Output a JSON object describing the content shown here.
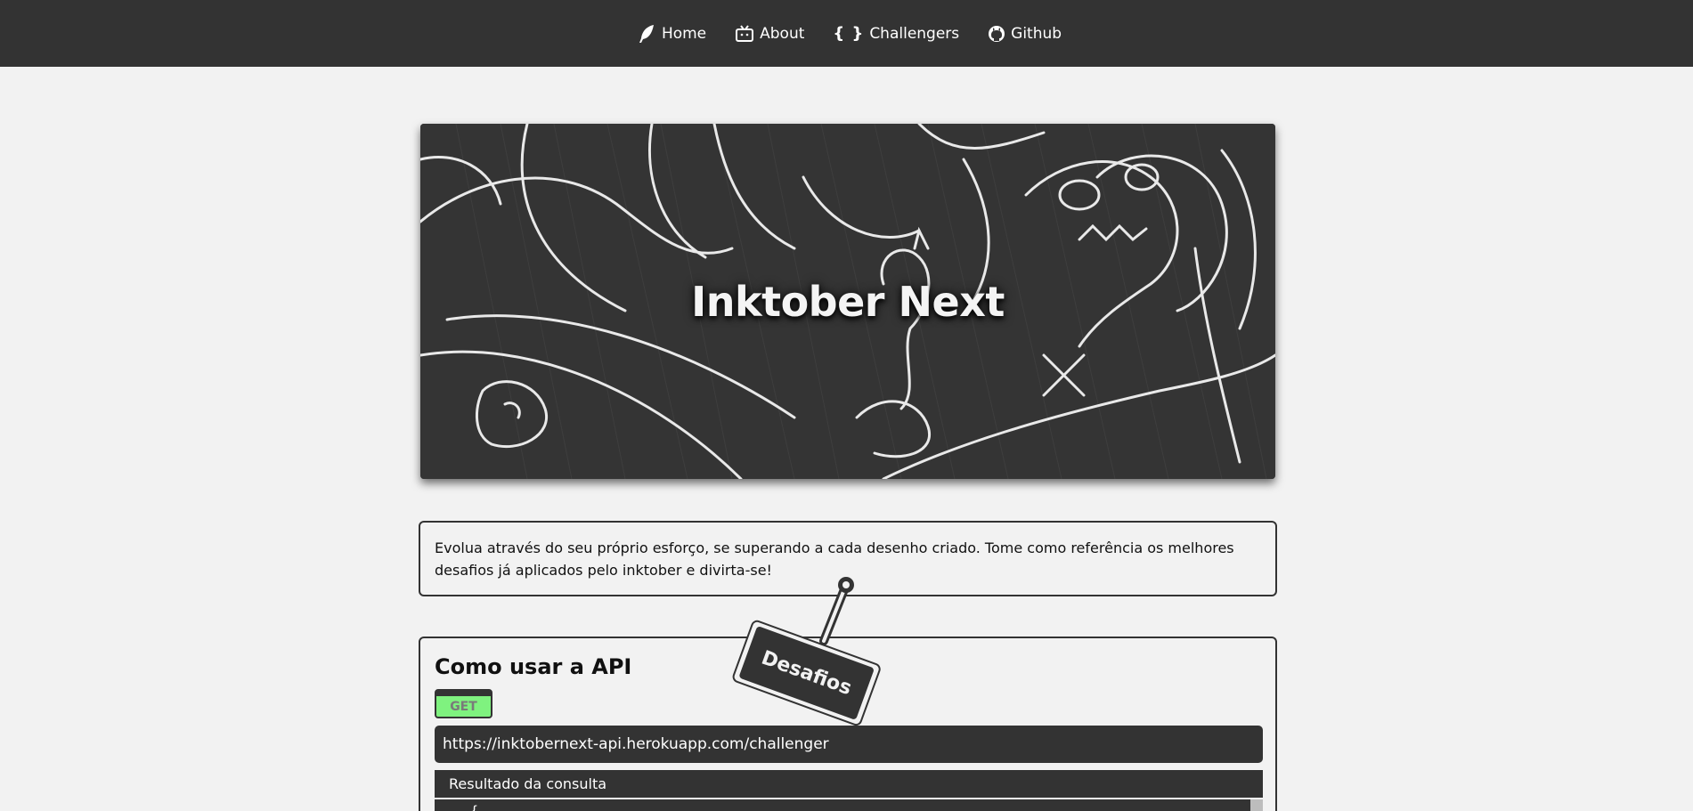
{
  "nav": {
    "items": [
      {
        "label": "Home",
        "icon": "feather-icon"
      },
      {
        "label": "About",
        "icon": "tv-icon"
      },
      {
        "label": "Challengers",
        "icon": "braces-icon",
        "glyph": "{ }"
      },
      {
        "label": "Github",
        "icon": "github-icon"
      }
    ]
  },
  "banner": {
    "title": "Inktober Next"
  },
  "intro": {
    "text": "Evolua através do seu próprio esforço, se superando a cada desenho criado. Tome como referência os melhores desafios já aplicados pelo inktober e divirta-se!"
  },
  "hanging_tag": {
    "label": "Desafios"
  },
  "api": {
    "title": "Como usar a API",
    "method": "GET",
    "endpoint": "https://inktobernext-api.herokuapp.com/challenger",
    "result_label": "Resultado da consulta",
    "result_preview": "{"
  },
  "colors": {
    "nav_bg": "#333333",
    "page_bg": "#f2f2f2",
    "method_green": "#7ff27f"
  }
}
